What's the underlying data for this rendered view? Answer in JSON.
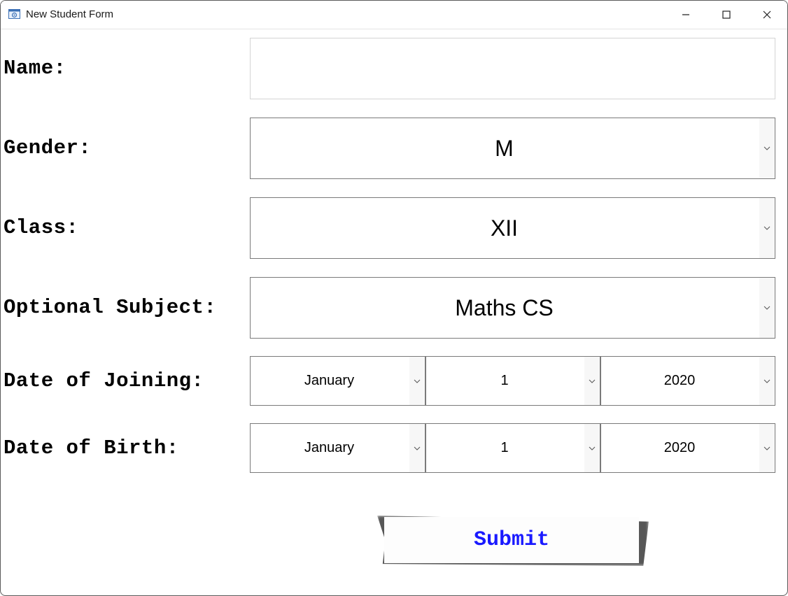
{
  "window": {
    "title": "New Student Form",
    "icon": "form-window-icon",
    "controls": [
      "minimize-icon",
      "maximize-icon",
      "close-icon"
    ]
  },
  "form": {
    "name": {
      "label": "Name:",
      "value": "",
      "placeholder": ""
    },
    "gender": {
      "label": "Gender:",
      "selected": "M"
    },
    "class": {
      "label": "Class:",
      "selected": "XII"
    },
    "optional_subject": {
      "label": "Optional Subject:",
      "selected": "Maths CS"
    },
    "date_of_joining": {
      "label": "Date of Joining:",
      "month": "January",
      "day": "1",
      "year": "2020"
    },
    "date_of_birth": {
      "label": "Date of Birth:",
      "month": "January",
      "day": "1",
      "year": "2020"
    },
    "submit_label": "Submit"
  },
  "colors": {
    "submit_text": "#1a1aff",
    "border": "#7a7a7a"
  }
}
